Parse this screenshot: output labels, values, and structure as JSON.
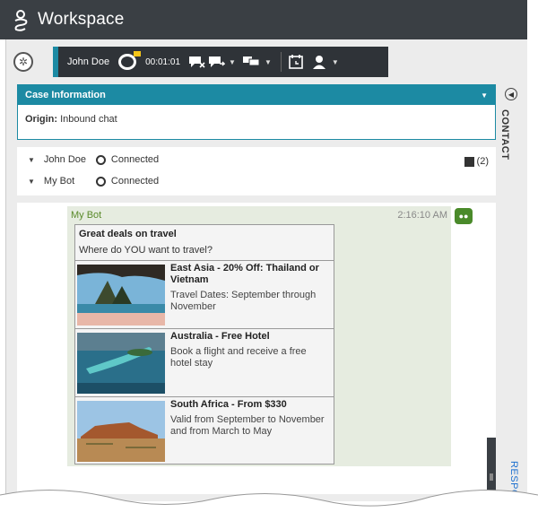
{
  "app": {
    "title": "Workspace"
  },
  "toolbar": {
    "party_name": "John Doe",
    "timer": "00:01:01",
    "icons": [
      "settings-icon",
      "chat-icon",
      "end-chat-icon",
      "transfer-chat-icon",
      "conference-icon",
      "schedule-icon",
      "consult-icon"
    ]
  },
  "case_info": {
    "header": "Case Information",
    "origin_label": "Origin:",
    "origin_value": "Inbound chat"
  },
  "parties": [
    {
      "name": "John Doe",
      "status": "Connected"
    },
    {
      "name": "My Bot",
      "status": "Connected"
    }
  ],
  "notes_count": "(2)",
  "side_tabs": {
    "contact": "CONTACT",
    "responses": "RESPONSES"
  },
  "message": {
    "sender": "My Bot",
    "time": "2:16:10 AM",
    "card": {
      "title": "Great deals on travel",
      "subtitle": "Where do YOU want to travel?",
      "deals": [
        {
          "title": "East Asia - 20% Off: Thailand or Vietnam",
          "desc": "Travel Dates: September through November"
        },
        {
          "title": "Australia - Free Hotel",
          "desc": "Book a flight and receive a free hotel stay"
        },
        {
          "title": "South Africa - From $330",
          "desc": "Valid from September to November and from March to May"
        }
      ]
    }
  },
  "colors": {
    "accent": "#1c8aa3",
    "titlebar": "#3a3f44",
    "bot_green": "#5a8a2a"
  }
}
